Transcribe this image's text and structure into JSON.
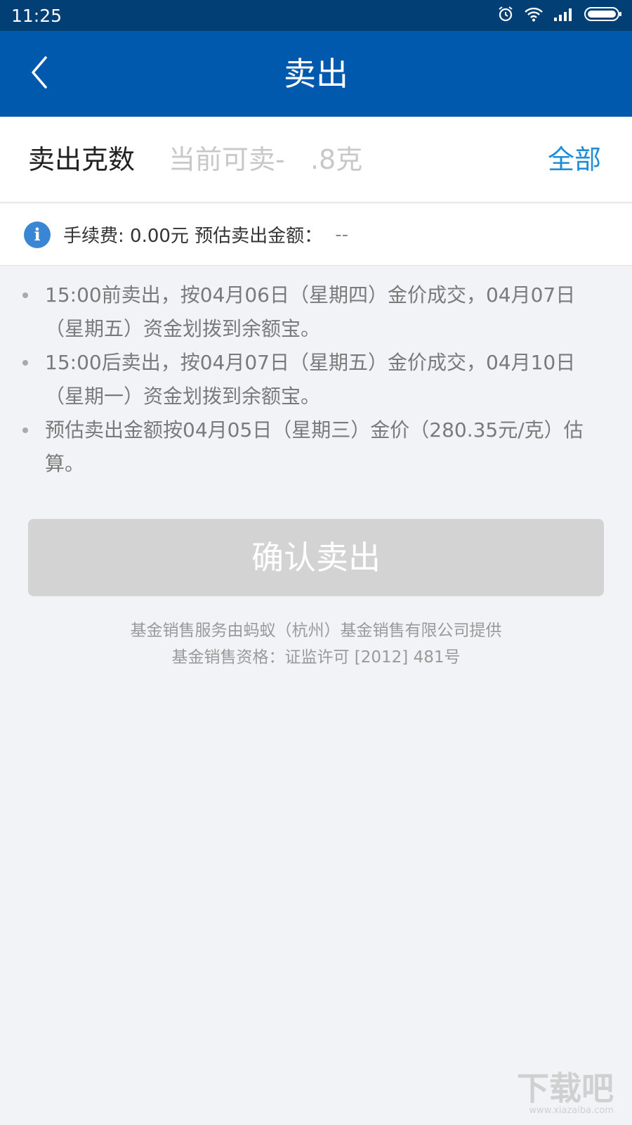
{
  "status_bar": {
    "time": "11:25",
    "icons": [
      "alarm-icon",
      "wifi-icon",
      "signal-icon",
      "battery-icon"
    ]
  },
  "nav": {
    "title": "卖出",
    "back_icon": "chevron-left-icon"
  },
  "sell_input": {
    "label": "卖出克数",
    "placeholder": "当前可卖-   .8克",
    "value": "",
    "all_button": "全部"
  },
  "fee": {
    "icon": "info-icon",
    "text": "手续费: 0.00元 预估卖出金额：",
    "value": "--"
  },
  "notes": [
    "15:00前卖出，按04月06日（星期四）金价成交，04月07日（星期五）资金划拨到余额宝。",
    "15:00后卖出，按04月07日（星期五）金价成交，04月10日（星期一）资金划拨到余额宝。",
    "预估卖出金额按04月05日（星期三）金价（280.35元/克）估算。"
  ],
  "confirm_button": "确认卖出",
  "footer": {
    "line1": "基金销售服务由蚂蚁（杭州）基金销售有限公司提供",
    "line2": "基金销售资格：证监许可 [2012] 481号"
  },
  "watermark": {
    "text": "下载吧",
    "sub": "www.xiazaiba.com"
  },
  "colors": {
    "status_bar": "#023f75",
    "nav_bar": "#0059ac",
    "link": "#1f8ed6",
    "info_icon": "#3a86d4",
    "button_disabled": "#d3d3d3",
    "page_bg": "#f1f3f6"
  }
}
